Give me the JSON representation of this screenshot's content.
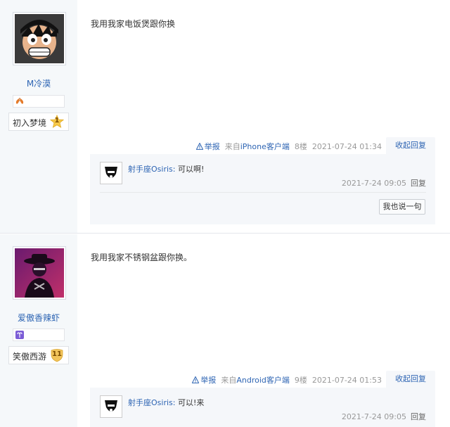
{
  "posts": [
    {
      "username": "M冷漠",
      "level_title": "初入梦境",
      "level_num": "1",
      "content": "我用我家电饭煲跟你换",
      "tail": {
        "report": "举报",
        "client_prefix": "来自",
        "client": "iPhone客户端",
        "floor": "8楼",
        "time": "2021-07-24 01:34",
        "fold": "收起回复"
      },
      "reply": {
        "name": "射手座Osiris",
        "text": "可以啊!",
        "time": "2021-7-24 09:05",
        "reply_label": "回复"
      },
      "say_button": "我也说一句"
    },
    {
      "username": "爱傲香辣虾",
      "level_title": "笑傲西游",
      "level_num": "11",
      "content": "我用我家不锈钢盆跟你换。",
      "tail": {
        "report": "举报",
        "client_prefix": "来自",
        "client": "Android客户端",
        "floor": "9楼",
        "time": "2021-07-24 01:53",
        "fold": "收起回复"
      },
      "reply": {
        "name": "射手座Osiris",
        "text": "可以!来",
        "time": "2021-7-24 09:05",
        "reply_label": "回复"
      }
    }
  ],
  "colors": {
    "link": "#2d64b3",
    "sidebar_bg": "#f5f8fa",
    "reply_bg": "#f5f7fa",
    "meta_text": "#999999"
  }
}
